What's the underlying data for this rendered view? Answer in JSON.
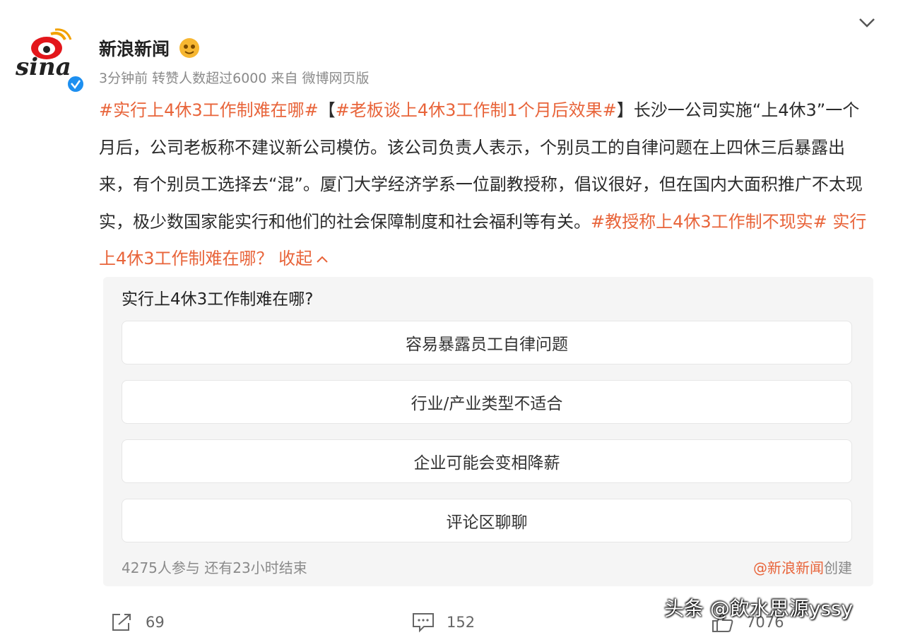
{
  "post": {
    "author": "新浪新闻",
    "meta": "3分钟前  转赞人数超过6000   来自  微博网页版",
    "segments": [
      {
        "text": "#实行上4休3工作制难在哪#",
        "type": "tag"
      },
      {
        "text": "【",
        "type": "text"
      },
      {
        "text": "#老板谈上4休3工作制1个月后效果#",
        "type": "tag"
      },
      {
        "text": "】长沙一公司实施“上4休3”一个月后，公司老板称不建议新公司模仿。该公司负责人表示，个别员工的自律问题在上四休三后暴露出来，有个别员工选择去“混”。厦门大学经济学系一位副教授称，倡议很好，但在国内大面积推广不太现实，极少数国家能实行和他们的社会保障制度和社会福利等有关。",
        "type": "text"
      },
      {
        "text": "#教授称上4休3工作制不现实#",
        "type": "tag"
      },
      {
        "text": " 实行上4休3工作制难在哪？ ",
        "type": "tag"
      },
      {
        "text": " 收起",
        "type": "tag"
      }
    ]
  },
  "poll": {
    "question": "实行上4休3工作制难在哪?",
    "options": [
      "容易暴露员工自律问题",
      "行业/产业类型不适合",
      "企业可能会变相降薪",
      "评论区聊聊"
    ],
    "participants": "4275人参与  还有23小时结束",
    "creator_at": "@新浪新闻",
    "creator_suffix": "创建"
  },
  "actions": {
    "share": "69",
    "comment": "152",
    "like": "7076"
  },
  "watermark": "头条 @飲水思源yssy",
  "colors": {
    "accent": "#e8643a",
    "gray": "#8a8a8a"
  },
  "icons": [
    "chevron-down-icon",
    "sina-logo",
    "emoji-badge-icon",
    "verified-icon",
    "share-icon",
    "comment-icon",
    "like-icon"
  ]
}
